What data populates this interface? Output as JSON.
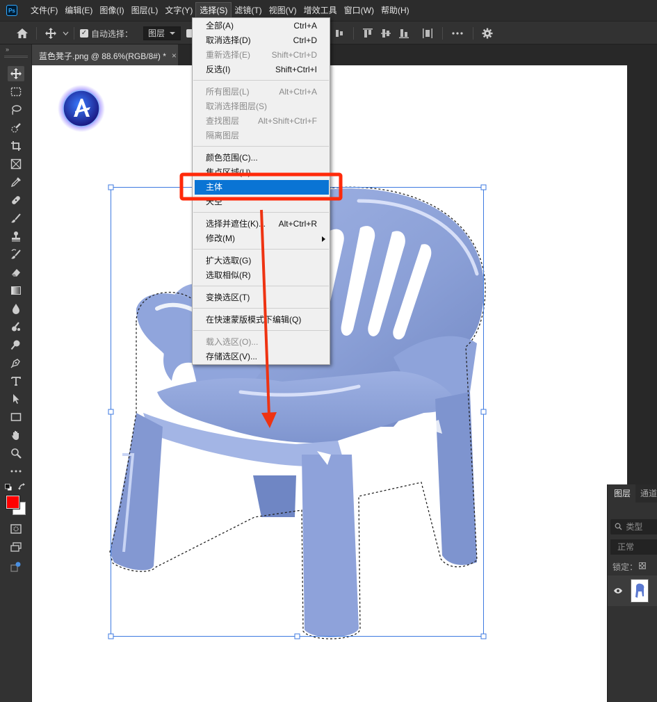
{
  "app": {
    "logo_text": "Ps"
  },
  "menubar": {
    "items": [
      "文件(F)",
      "编辑(E)",
      "图像(I)",
      "图层(L)",
      "文字(Y)",
      "选择(S)",
      "滤镜(T)",
      "视图(V)",
      "增效工具",
      "窗口(W)",
      "帮助(H)"
    ],
    "active": "选择(S)"
  },
  "options_bar": {
    "auto_select_label": "自动选择：",
    "auto_select_checked": true,
    "auto_select_target": "图层",
    "icons": [
      "home-icon",
      "move-icon",
      "align-top-icon",
      "align-vcenter-icon",
      "align-bottom-icon",
      "distribute-icon",
      "more-icon",
      "gear-icon"
    ]
  },
  "document_tab": {
    "title": "蓝色凳子.png @ 88.6%(RGB/8#) *",
    "close_glyph": "×"
  },
  "toolbar": {
    "collapse_glyph": "»",
    "tools": [
      "move-tool-icon",
      "marquee-tool-icon",
      "lasso-tool-icon",
      "quick-select-tool-icon",
      "crop-tool-icon",
      "frame-tool-icon",
      "eyedropper-tool-icon",
      "healing-brush-tool-icon",
      "brush-tool-icon",
      "clone-stamp-tool-icon",
      "history-brush-tool-icon",
      "eraser-tool-icon",
      "gradient-tool-icon",
      "blur-tool-icon",
      "smudge-tool-icon",
      "dodge-tool-icon",
      "pen-tool-icon",
      "type-tool-icon",
      "path-select-tool-icon",
      "rectangle-tool-icon",
      "hand-tool-icon",
      "zoom-tool-icon",
      "more-tools-icon"
    ],
    "foreground_color": "#ff0000",
    "background_color": "#ffffff"
  },
  "select_menu": {
    "groups": [
      [
        {
          "label": "全部(A)",
          "shortcut": "Ctrl+A",
          "disabled": false
        },
        {
          "label": "取消选择(D)",
          "shortcut": "Ctrl+D",
          "disabled": false
        },
        {
          "label": "重新选择(E)",
          "shortcut": "Shift+Ctrl+D",
          "disabled": true
        },
        {
          "label": "反选(I)",
          "shortcut": "Shift+Ctrl+I",
          "disabled": false
        }
      ],
      [
        {
          "label": "所有图层(L)",
          "shortcut": "Alt+Ctrl+A",
          "disabled": true
        },
        {
          "label": "取消选择图层(S)",
          "shortcut": "",
          "disabled": true
        },
        {
          "label": "查找图层",
          "shortcut": "Alt+Shift+Ctrl+F",
          "disabled": true
        },
        {
          "label": "隔离图层",
          "shortcut": "",
          "disabled": true
        }
      ],
      [
        {
          "label": "颜色范围(C)...",
          "shortcut": "",
          "disabled": false
        },
        {
          "label": "焦点区域(U)...",
          "shortcut": "",
          "disabled": false
        },
        {
          "label": "主体",
          "shortcut": "",
          "disabled": false,
          "highlighted": true
        },
        {
          "label": "天空",
          "shortcut": "",
          "disabled": false
        }
      ],
      [
        {
          "label": "选择并遮住(K)...",
          "shortcut": "Alt+Ctrl+R",
          "disabled": false
        },
        {
          "label": "修改(M)",
          "shortcut": "",
          "disabled": false,
          "submenu": true
        }
      ],
      [
        {
          "label": "扩大选取(G)",
          "shortcut": "",
          "disabled": false
        },
        {
          "label": "选取相似(R)",
          "shortcut": "",
          "disabled": false
        }
      ],
      [
        {
          "label": "变换选区(T)",
          "shortcut": "",
          "disabled": false
        }
      ],
      [
        {
          "label": "在快速蒙版模式下编辑(Q)",
          "shortcut": "",
          "disabled": false
        }
      ],
      [
        {
          "label": "载入选区(O)...",
          "shortcut": "",
          "disabled": true
        },
        {
          "label": "存储选区(V)...",
          "shortcut": "",
          "disabled": false
        }
      ]
    ]
  },
  "annotation": {
    "highlight_color": "#ff2a0a",
    "arrow_color": "#ee3312"
  },
  "layers_panel": {
    "tabs": [
      "图层",
      "通道"
    ],
    "search_placeholder": "类型",
    "blend_mode": "正常",
    "lock_label": "锁定："
  },
  "canvas": {
    "chair_color": "#8da2d8"
  }
}
